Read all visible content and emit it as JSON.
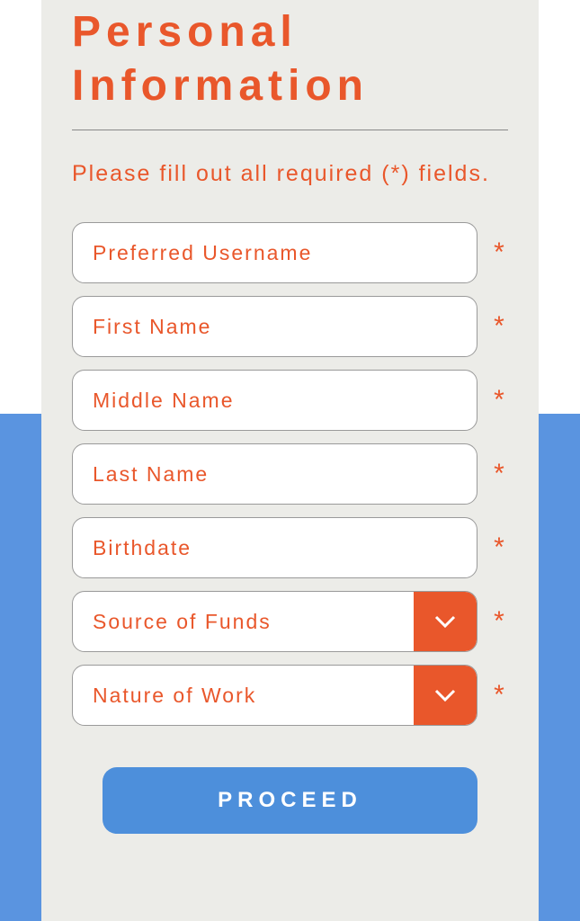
{
  "title": "Personal Information",
  "instruction": "Please fill out all required (*) fields.",
  "asterisk": "*",
  "fields": {
    "username": {
      "placeholder": "Preferred Username"
    },
    "firstname": {
      "placeholder": "First Name"
    },
    "middlename": {
      "placeholder": "Middle Name"
    },
    "lastname": {
      "placeholder": "Last Name"
    },
    "birthdate": {
      "placeholder": "Birthdate"
    },
    "sourceoffunds": {
      "label": "Source of Funds"
    },
    "natureofwork": {
      "label": "Nature of Work"
    }
  },
  "proceed_label": "PROCEED"
}
